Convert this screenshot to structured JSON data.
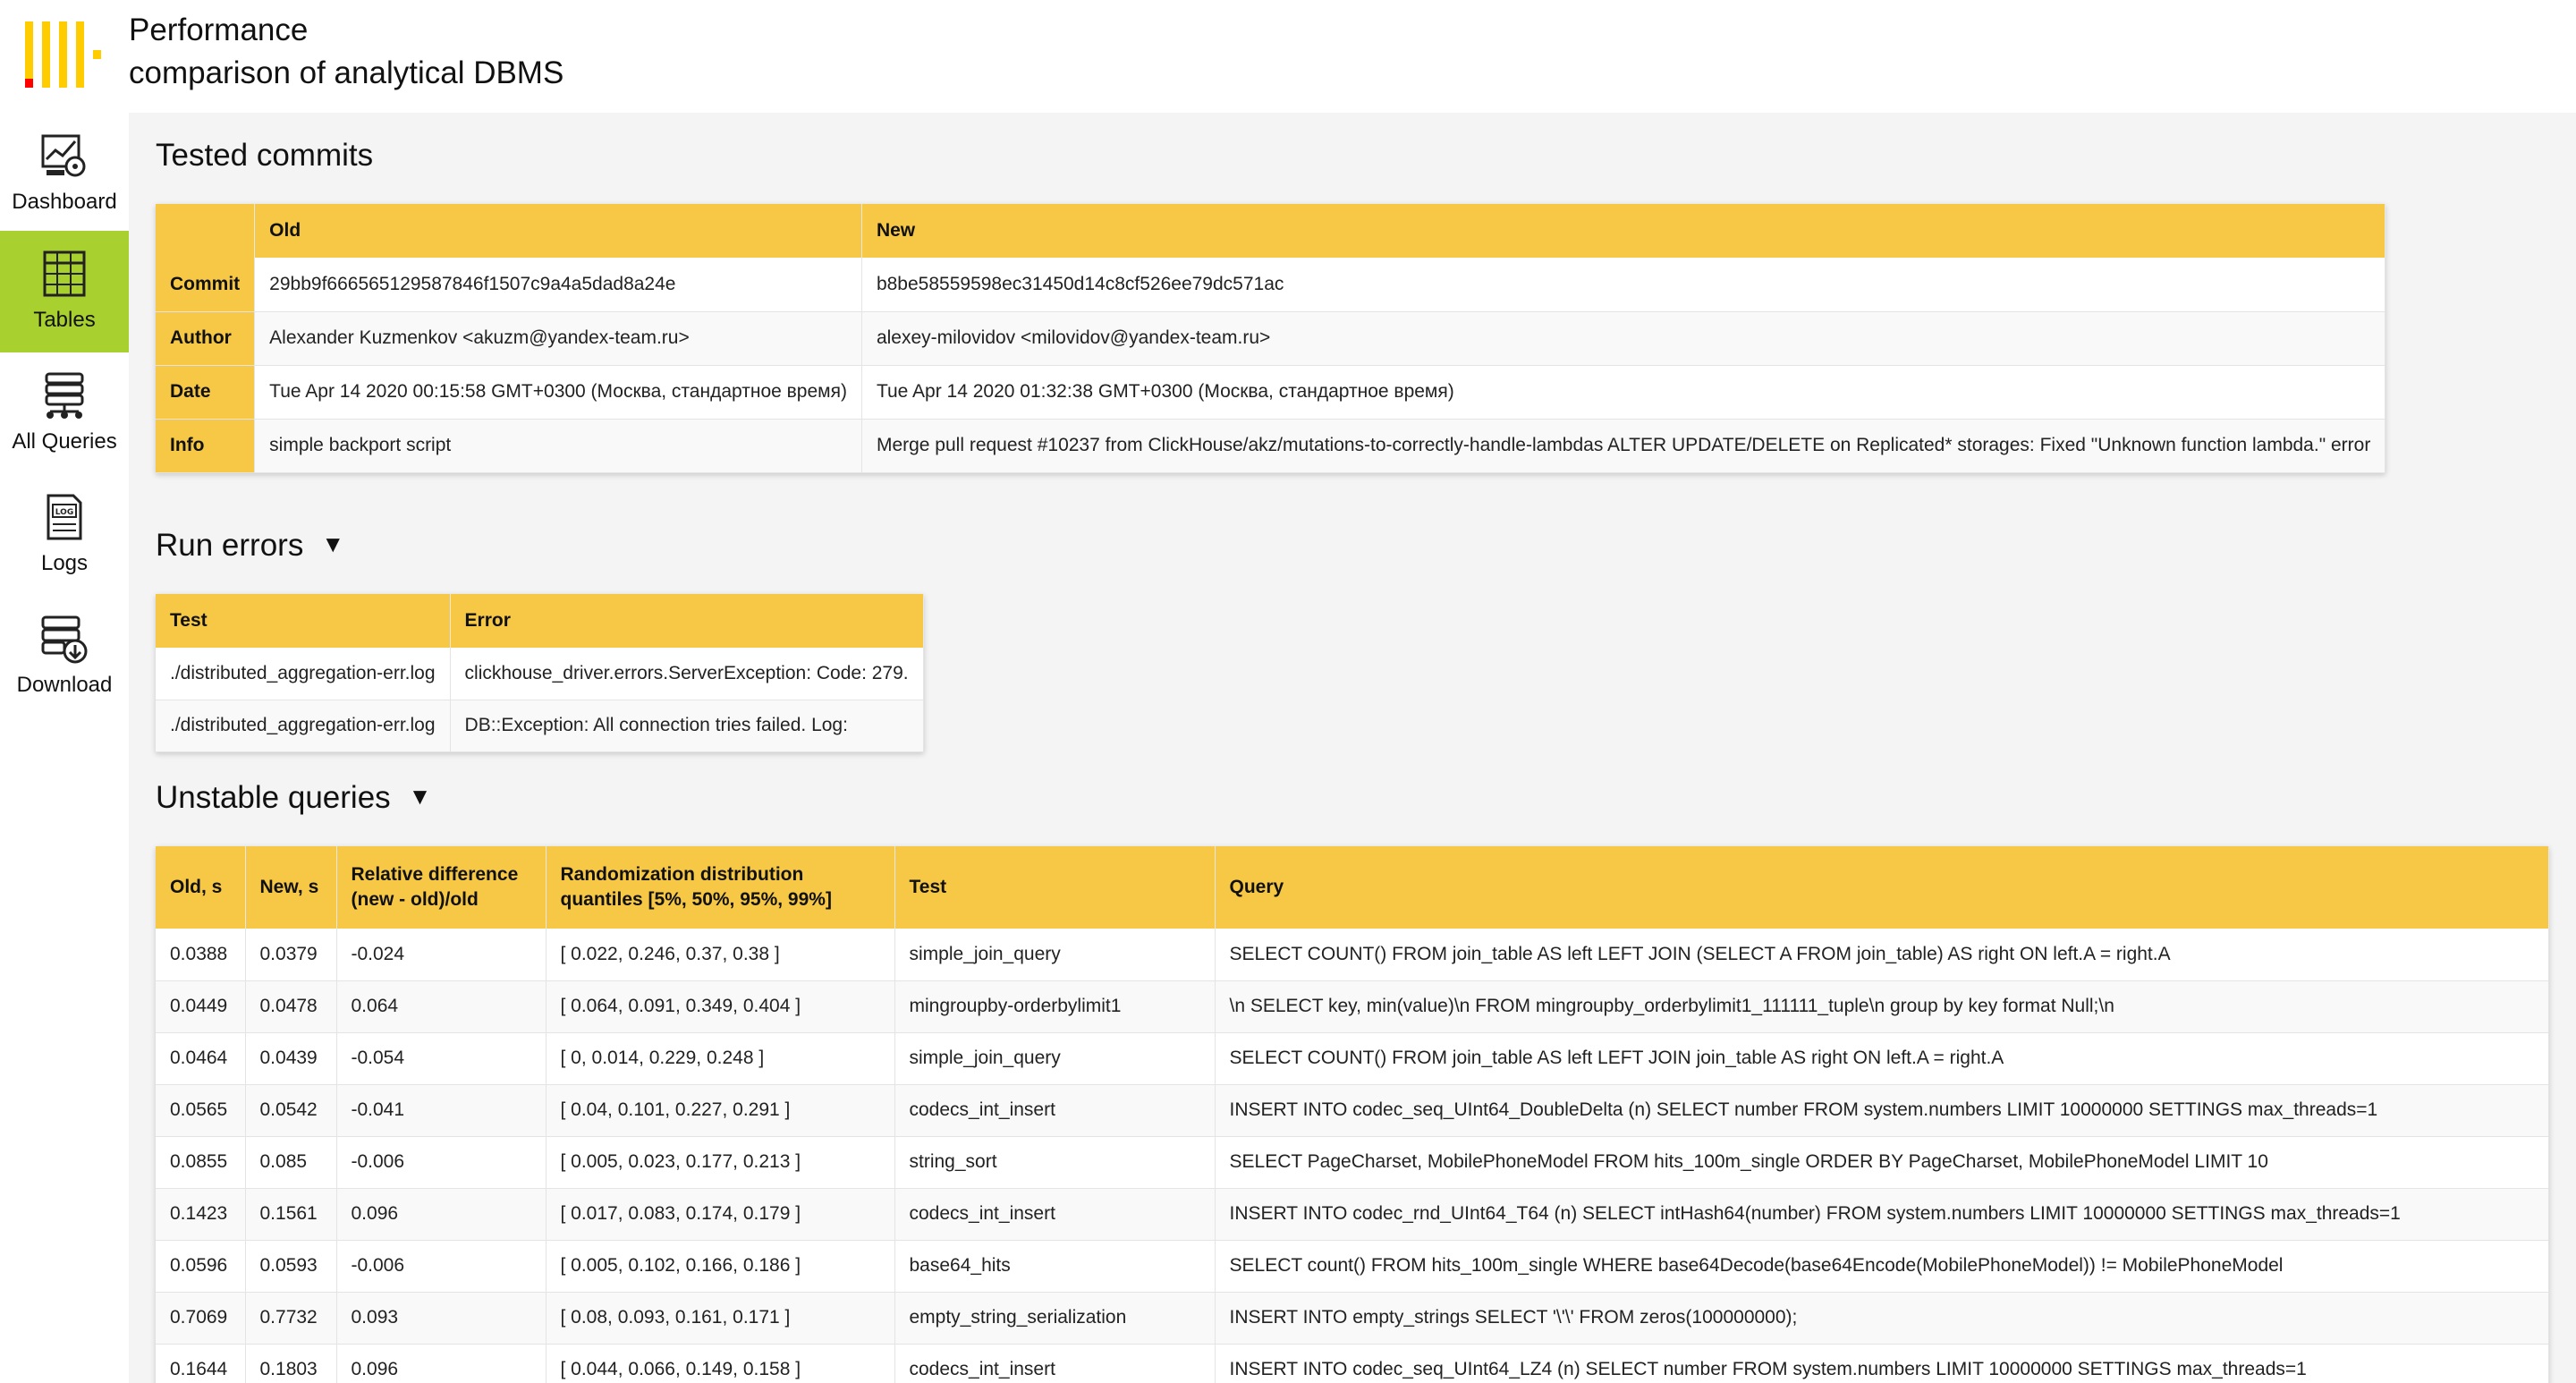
{
  "app": {
    "title_line1": "Performance",
    "title_line2": "comparison of analytical DBMS"
  },
  "sidebar": {
    "items": [
      {
        "label": "Dashboard",
        "icon": "dashboard-icon",
        "active": false
      },
      {
        "label": "Tables",
        "icon": "table-icon",
        "active": true
      },
      {
        "label": "All Queries",
        "icon": "queries-icon",
        "active": false
      },
      {
        "label": "Logs",
        "icon": "log-icon",
        "active": false
      },
      {
        "label": "Download",
        "icon": "download-icon",
        "active": false
      }
    ]
  },
  "colors": {
    "accent": "#f6c846",
    "active_nav": "#a8d02e",
    "logo_yellow": "#ffcc00",
    "logo_red": "#ff0000"
  },
  "commits": {
    "title": "Tested commits",
    "headers": [
      "",
      "Old",
      "New"
    ],
    "rows": [
      {
        "label": "Commit",
        "old": "29bb9f666565129587846f1507c9a4a5dad8a24e",
        "new": "b8be58559598ec31450d14c8cf526ee79dc571ac"
      },
      {
        "label": "Author",
        "old": "Alexander Kuzmenkov <akuzm@yandex-team.ru>",
        "new": "alexey-milovidov <milovidov@yandex-team.ru>"
      },
      {
        "label": "Date",
        "old": "Tue Apr 14 2020 00:15:58 GMT+0300 (Москва, стандартное время)",
        "new": "Tue Apr 14 2020 01:32:38 GMT+0300 (Москва, стандартное время)"
      },
      {
        "label": "Info",
        "old": "simple backport script",
        "new": "Merge pull request #10237 from ClickHouse/akz/mutations-to-correctly-handle-lambdas ALTER UPDATE/DELETE on Replicated* storages: Fixed \"Unknown function lambda.\" error"
      }
    ]
  },
  "errors": {
    "title": "Run errors",
    "headers": [
      "Test",
      "Error"
    ],
    "rows": [
      [
        "./distributed_aggregation-err.log",
        "clickhouse_driver.errors.ServerException: Code: 279."
      ],
      [
        "./distributed_aggregation-err.log",
        "DB::Exception: All connection tries failed. Log:"
      ]
    ]
  },
  "unstable": {
    "title": "Unstable queries",
    "headers": [
      "Old, s",
      "New, s",
      "Relative difference (new - old)/old",
      "Randomization distribution quantiles [5%, 50%, 95%, 99%]",
      "Test",
      "Query"
    ],
    "rows": [
      [
        "0.0388",
        "0.0379",
        "-0.024",
        "[ 0.022, 0.246, 0.37, 0.38 ]",
        "simple_join_query",
        "SELECT COUNT() FROM join_table AS left LEFT JOIN (SELECT A FROM join_table) AS right ON left.A = right.A"
      ],
      [
        "0.0449",
        "0.0478",
        "0.064",
        "[ 0.064, 0.091, 0.349, 0.404 ]",
        "mingroupby-orderbylimit1",
        "\\n SELECT key, min(value)\\n FROM mingroupby_orderbylimit1_111111_tuple\\n group by key format Null;\\n"
      ],
      [
        "0.0464",
        "0.0439",
        "-0.054",
        "[ 0, 0.014, 0.229, 0.248 ]",
        "simple_join_query",
        "SELECT COUNT() FROM join_table AS left LEFT JOIN join_table AS right ON left.A = right.A"
      ],
      [
        "0.0565",
        "0.0542",
        "-0.041",
        "[ 0.04, 0.101, 0.227, 0.291 ]",
        "codecs_int_insert",
        "INSERT INTO codec_seq_UInt64_DoubleDelta (n) SELECT number FROM system.numbers LIMIT 10000000 SETTINGS max_threads=1"
      ],
      [
        "0.0855",
        "0.085",
        "-0.006",
        "[ 0.005, 0.023, 0.177, 0.213 ]",
        "string_sort",
        "SELECT PageCharset, MobilePhoneModel FROM hits_100m_single ORDER BY PageCharset, MobilePhoneModel LIMIT 10"
      ],
      [
        "0.1423",
        "0.1561",
        "0.096",
        "[ 0.017, 0.083, 0.174, 0.179 ]",
        "codecs_int_insert",
        "INSERT INTO codec_rnd_UInt64_T64 (n) SELECT intHash64(number) FROM system.numbers LIMIT 10000000 SETTINGS max_threads=1"
      ],
      [
        "0.0596",
        "0.0593",
        "-0.006",
        "[ 0.005, 0.102, 0.166, 0.186 ]",
        "base64_hits",
        "SELECT count() FROM hits_100m_single WHERE base64Decode(base64Encode(MobilePhoneModel)) != MobilePhoneModel"
      ],
      [
        "0.7069",
        "0.7732",
        "0.093",
        "[ 0.08, 0.093, 0.161, 0.171 ]",
        "empty_string_serialization",
        "INSERT INTO empty_strings SELECT '\\'\\' FROM zeros(100000000);"
      ],
      [
        "0.1644",
        "0.1803",
        "0.096",
        "[ 0.044, 0.066, 0.149, 0.158 ]",
        "codecs_int_insert",
        "INSERT INTO codec_seq_UInt64_LZ4 (n) SELECT number FROM system.numbers LIMIT 10000000 SETTINGS max_threads=1"
      ]
    ]
  }
}
